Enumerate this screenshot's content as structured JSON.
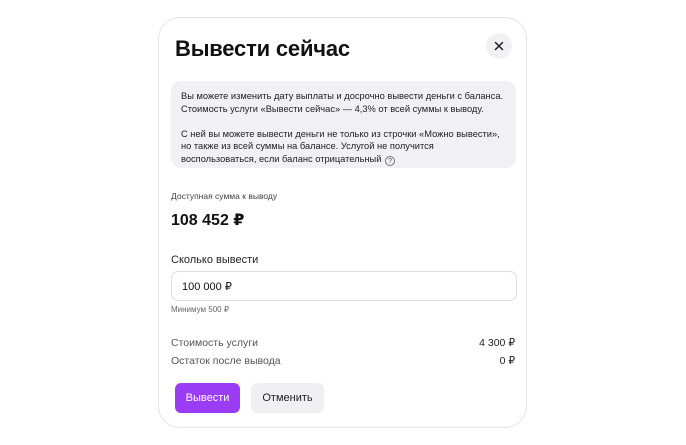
{
  "dialog": {
    "title": "Вывести сейчас",
    "close_icon": "close-icon",
    "info": {
      "paragraph1": "Вы можете изменить дату выплаты и досрочно вывести деньги с баланса. Стоимость услуги «Вывести сейчас» — 4,3% от всей суммы к выводу.",
      "paragraph2": "С ней вы можете вывести деньги не только из строчки «Можно вывести», но также из всей суммы на балансе. Услугой не получится воспользоваться, если баланс отрицательный",
      "help_icon": "question-circle-icon",
      "help_glyph": "?"
    },
    "available": {
      "label": "Доступная сумма к выводу",
      "amount": "108 452 ₽"
    },
    "withdraw": {
      "label": "Сколько вывести",
      "value": "100 000 ₽",
      "hint": "Минимум 500 ₽"
    },
    "summary": {
      "fee_label": "Стоимость услуги",
      "fee_value": "4 300 ₽",
      "remainder_label": "Остаток после вывода",
      "remainder_value": "0 ₽"
    },
    "buttons": {
      "primary": "Вывести",
      "secondary": "Отменить"
    },
    "colors": {
      "accent": "#9b3cf5",
      "info_bg": "#f0f0f5"
    }
  }
}
